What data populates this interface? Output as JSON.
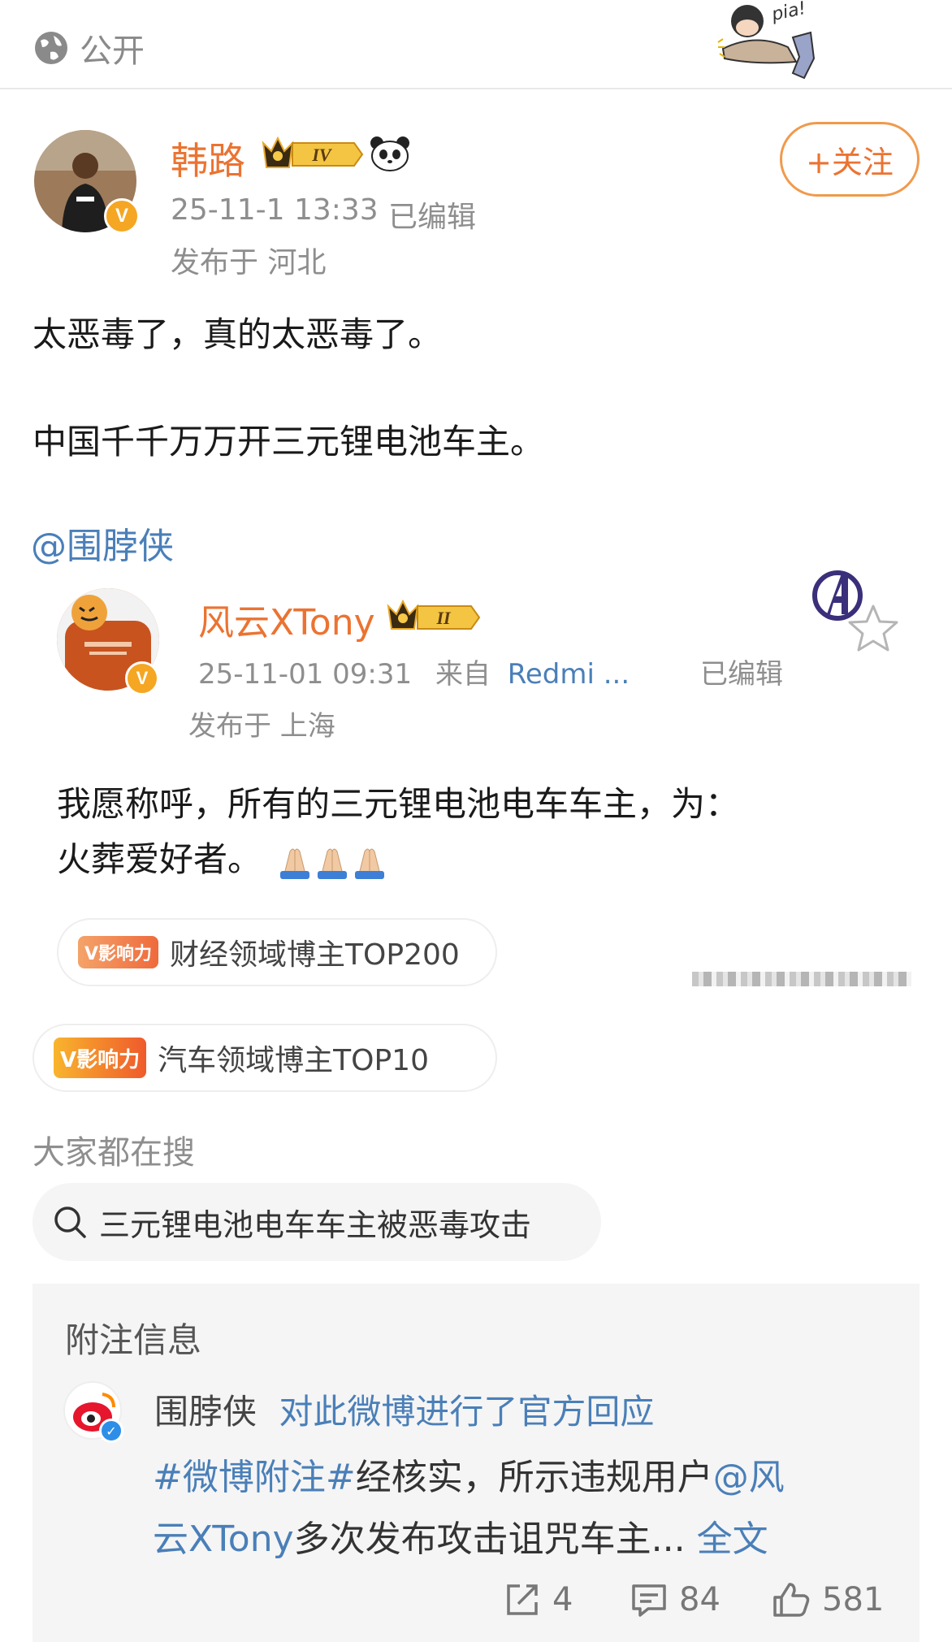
{
  "header": {
    "visibility_label": "公开",
    "sticker_text": "pia!"
  },
  "post": {
    "author": "韩路",
    "level_badge": "IV",
    "timestamp": "25-11-1 13:33",
    "edited_label": "已编辑",
    "location": "发布于 河北",
    "follow_label": "+关注",
    "content_line1": "太恶毒了，真的太恶毒了。",
    "content_line2": "中国千千万万开三元锂电池车主。",
    "mention": "@围脖侠"
  },
  "repost": {
    "author": "风云XTony",
    "level_badge": "II",
    "timestamp": "25-11-01 09:31",
    "from_label": "来自",
    "source": "Redmi ...",
    "edited_label": "已编辑",
    "location": "发布于 上海",
    "text_line1": "我愿称呼，所有的三元锂电池电车车主，为：",
    "text_line2": "火葬爱好者。",
    "influence_badge_1": "V影响力",
    "influence_text_1": "财经领域博主TOP200"
  },
  "influence": {
    "badge": "V影响力",
    "text": "汽车领域博主TOP10"
  },
  "hot_search": {
    "title": "大家都在搜",
    "query": "三元锂电池电车车主被恶毒攻击"
  },
  "note": {
    "title": "附注信息",
    "author": "围脖侠",
    "action": "对此微博进行了官方回应",
    "hashtag": "#微博附注#",
    "body_part1": "经核实，所示违规用户",
    "mention_part1": "@风",
    "mention_part2": "云XTony",
    "body_part2": "多次发布攻击诅咒车主...",
    "full_text_link": "全文"
  },
  "actions": {
    "shares": "4",
    "comments": "84",
    "likes": "581"
  },
  "colors": {
    "username_orange": "#eb7331",
    "link_blue": "#4a7fb8",
    "meta_gray": "#8e8e8e"
  }
}
